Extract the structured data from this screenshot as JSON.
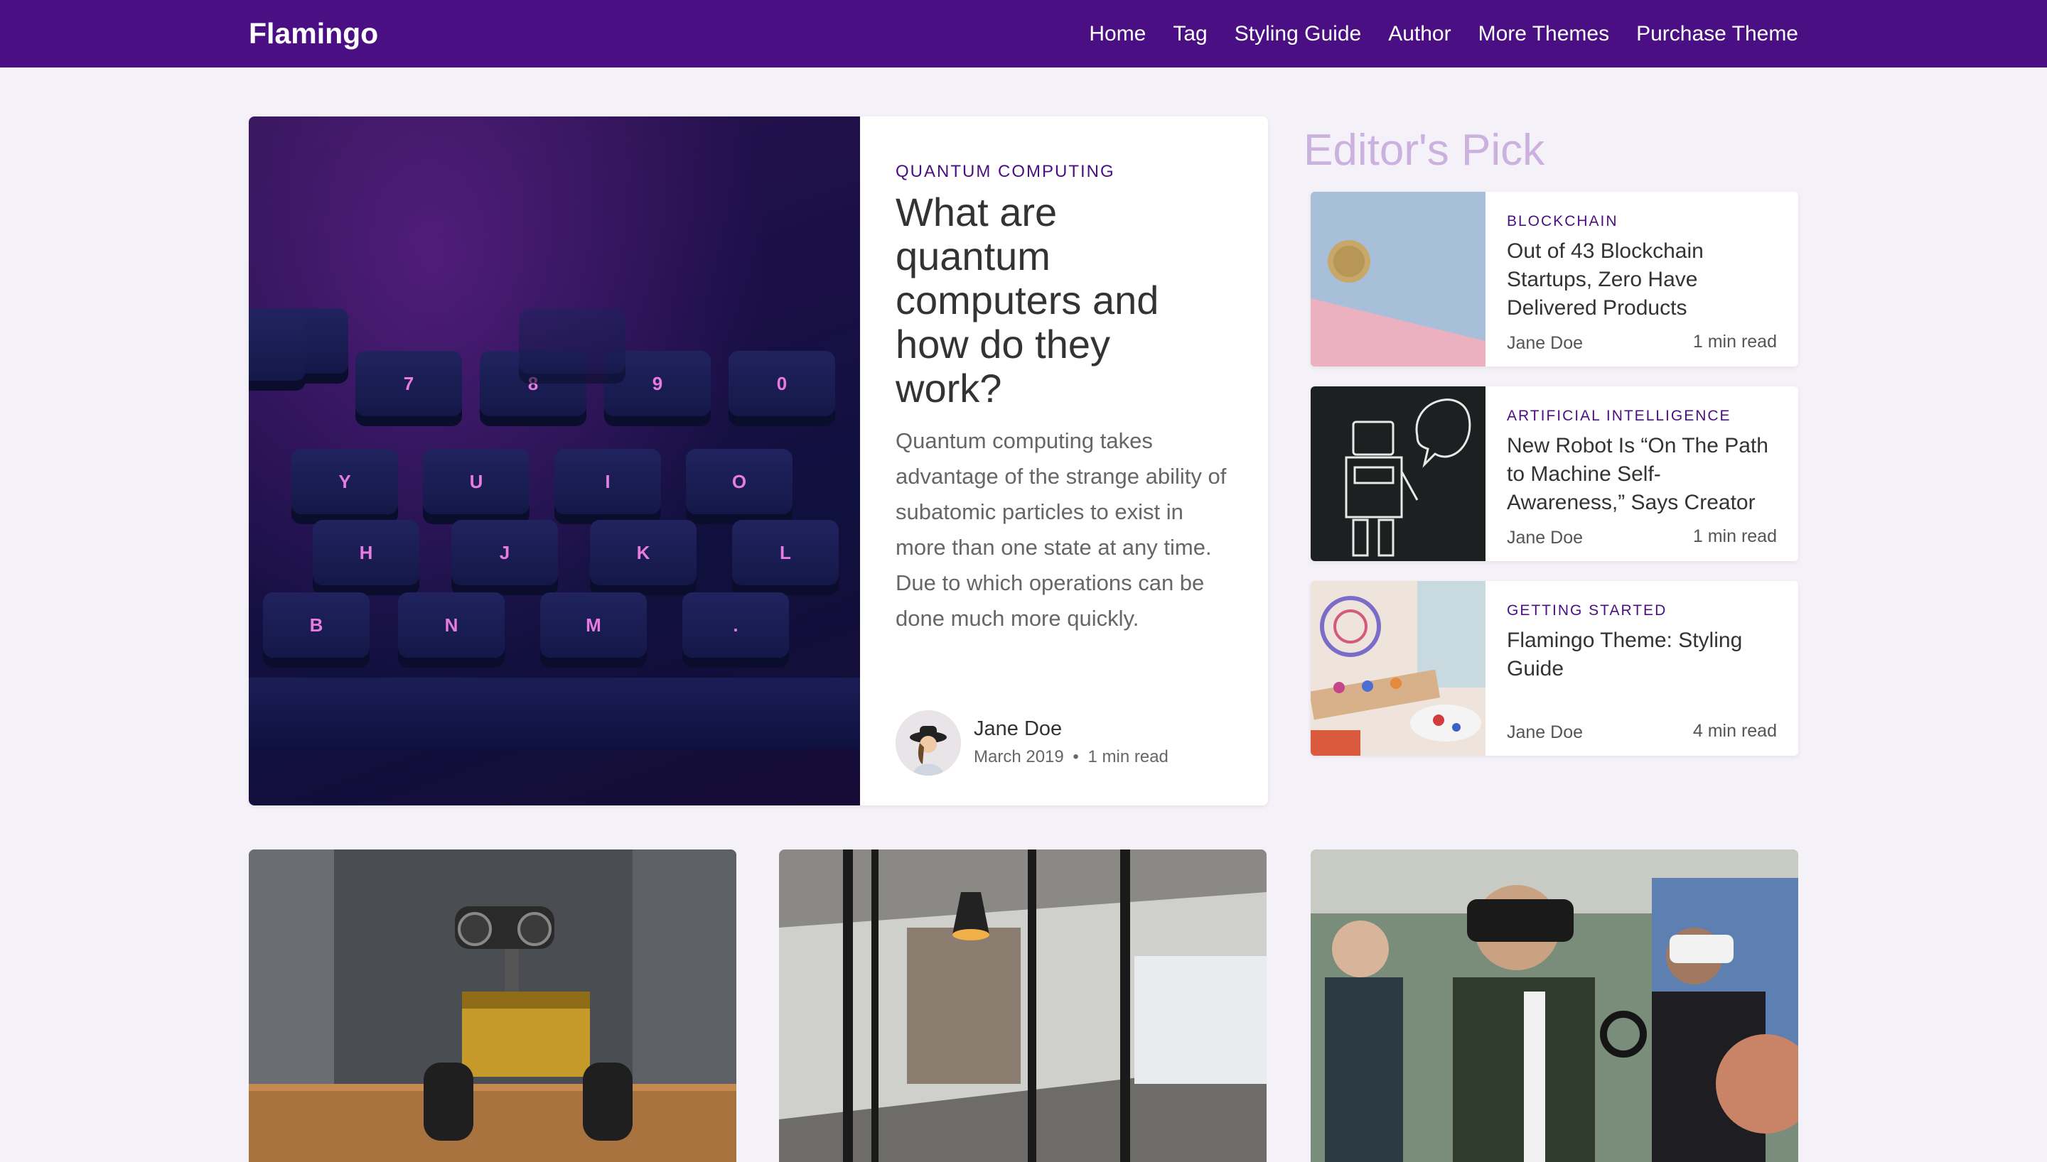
{
  "header": {
    "brand": "Flamingo",
    "nav": [
      "Home",
      "Tag",
      "Styling Guide",
      "Author",
      "More Themes",
      "Purchase Theme"
    ]
  },
  "hero": {
    "category": "QUANTUM COMPUTING",
    "title": "What are quantum computers and how do they work?",
    "excerpt": "Quantum computing takes advantage of the strange ability of subatomic particles to exist in more than one state at any time. Due to which operations can be done much more quickly.",
    "author": "Jane Doe",
    "date": "March 2019",
    "read_time": "1 min read",
    "separator": "•",
    "keys": [
      "7",
      "8",
      "9",
      "0",
      "Y",
      "U",
      "I",
      "O",
      "H",
      "J",
      "K",
      "L",
      "B",
      "N",
      "M",
      "."
    ]
  },
  "editors_pick": {
    "title": "Editor's Pick",
    "items": [
      {
        "category": "BLOCKCHAIN",
        "title": "Out of 43 Blockchain Startups, Zero Have Delivered Products",
        "author": "Jane Doe",
        "read_time": "1 min read"
      },
      {
        "category": "ARTIFICIAL INTELLIGENCE",
        "title": "New Robot Is “On The Path to Machine Self-Awareness,” Says Creator",
        "author": "Jane Doe",
        "read_time": "1 min read"
      },
      {
        "category": "GETTING STARTED",
        "title": "Flamingo Theme: Styling Guide",
        "author": "Jane Doe",
        "read_time": "4 min read"
      }
    ]
  },
  "colors": {
    "topbar": "#4a0f82",
    "accent": "#4a0f82",
    "background": "#f5f1f8",
    "editors_pick_heading": "#cbb1dd"
  },
  "icons": {
    "avatar": "author-avatar"
  }
}
